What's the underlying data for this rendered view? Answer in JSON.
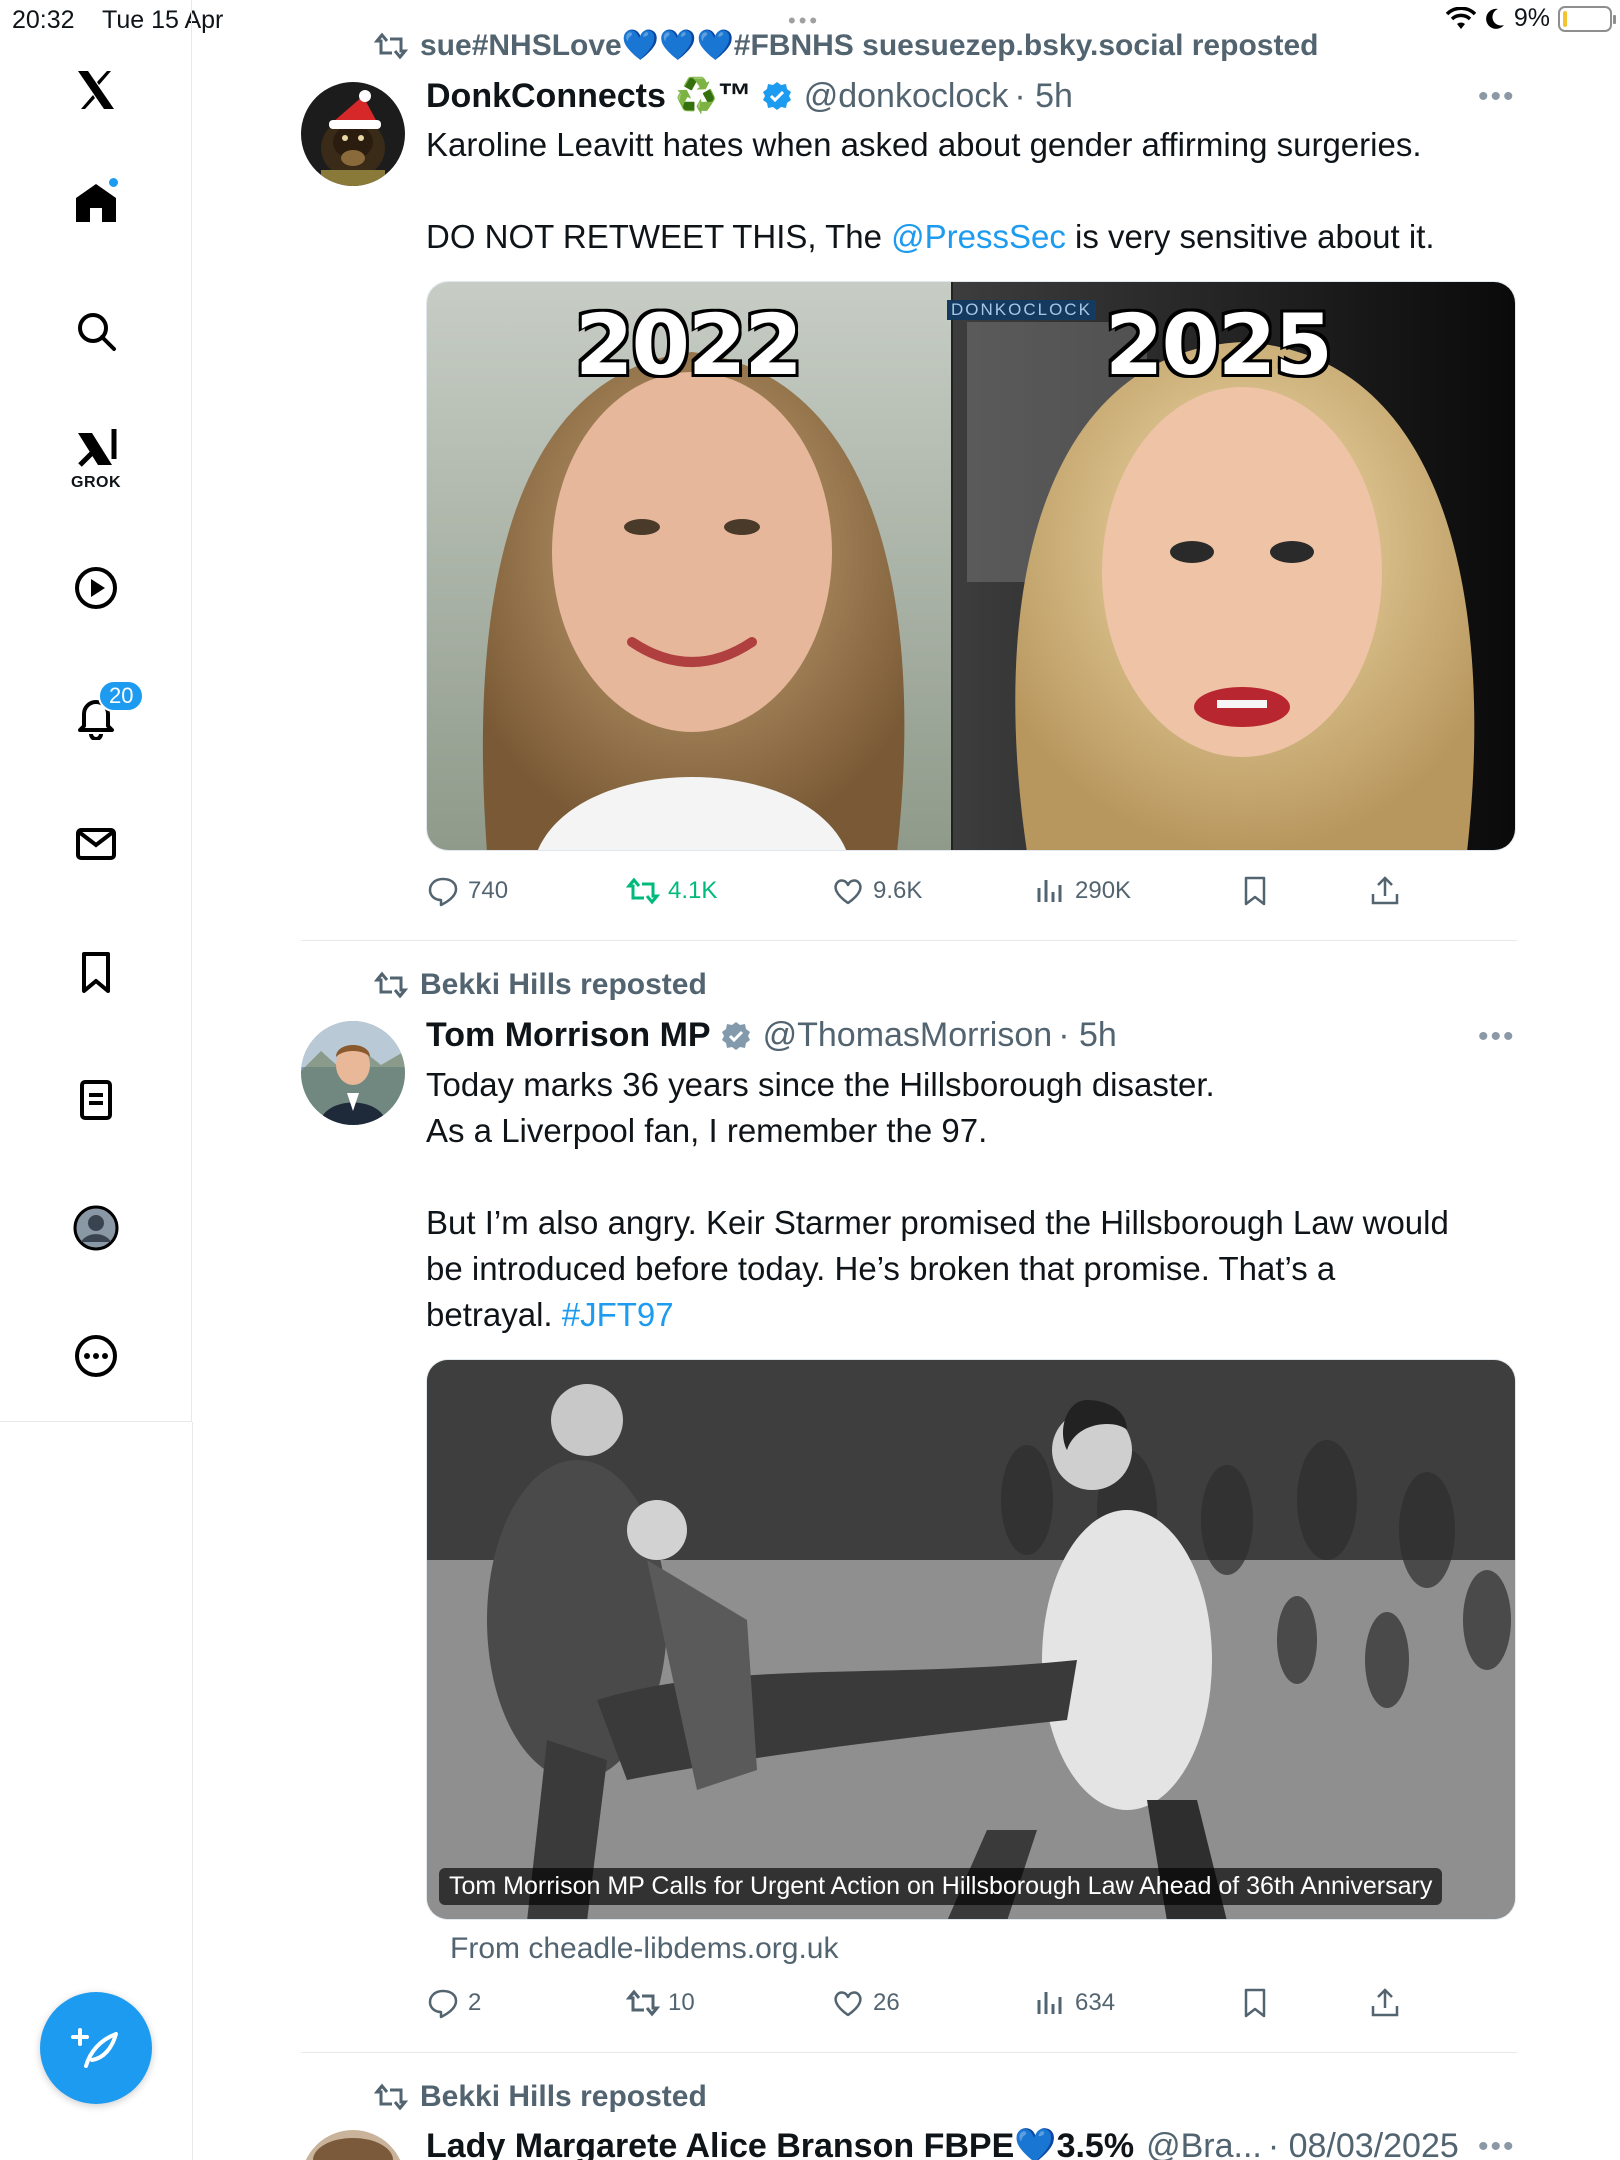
{
  "status_bar": {
    "time": "20:32",
    "date": "Tue 15 Apr",
    "battery": "9%",
    "battery_level": 0.09
  },
  "sidebar": {
    "grok_label": "GROK",
    "notifications_badge": "20",
    "items": [
      "x-logo",
      "home",
      "search",
      "grok",
      "video",
      "notifications",
      "messages",
      "bookmarks",
      "lists",
      "profile",
      "more"
    ]
  },
  "tweets": [
    {
      "reposted_by": "sue#NHSLove💙💙💙#FBNHS suesuezep.bsky.social reposted",
      "name": "DonkConnects ♻️™",
      "handle": "@donkoclock",
      "time": "· 5h",
      "text_line1": "Karoline Leavitt hates when asked about gender affirming surgeries.",
      "text_line2_pre": "DO NOT RETWEET THIS, The ",
      "text_line2_link": "@PressSec",
      "text_line2_post": " is very sensitive about it.",
      "media_labels": [
        "2022",
        "2025"
      ],
      "watermark": "DONKOCLOCK",
      "stats": {
        "replies": "740",
        "reposts": "4.1K",
        "likes": "9.6K",
        "views": "290K"
      }
    },
    {
      "reposted_by": "Bekki Hills reposted",
      "name": "Tom Morrison MP",
      "handle": "@ThomasMorrison",
      "time": "· 5h",
      "text_line1": "Today marks 36 years since the Hillsborough disaster.",
      "text_line2": "As a Liverpool fan, I remember the 97.",
      "text_line3": "But I’m also angry. Keir Starmer promised the Hillsborough Law would",
      "text_line4": "be introduced before today. He’s broken that promise. That’s a",
      "text_line5_pre": "betrayal. ",
      "text_line5_link": "#JFT97",
      "card_title": "Tom Morrison MP Calls for Urgent Action on Hillsborough Law Ahead of 36th Anniversary",
      "card_source": "From cheadle-libdems.org.uk",
      "stats": {
        "replies": "2",
        "reposts": "10",
        "likes": "26",
        "views": "634"
      }
    },
    {
      "reposted_by": "Bekki Hills reposted",
      "name": "Lady Margarete Alice Branson FBPE💙3.5%",
      "handle": "@Bra...",
      "time": "· 08/03/2025"
    }
  ],
  "colors": {
    "accent": "#1d9bf0",
    "repost_green": "#00ba7c",
    "secondary_text": "#536471"
  }
}
